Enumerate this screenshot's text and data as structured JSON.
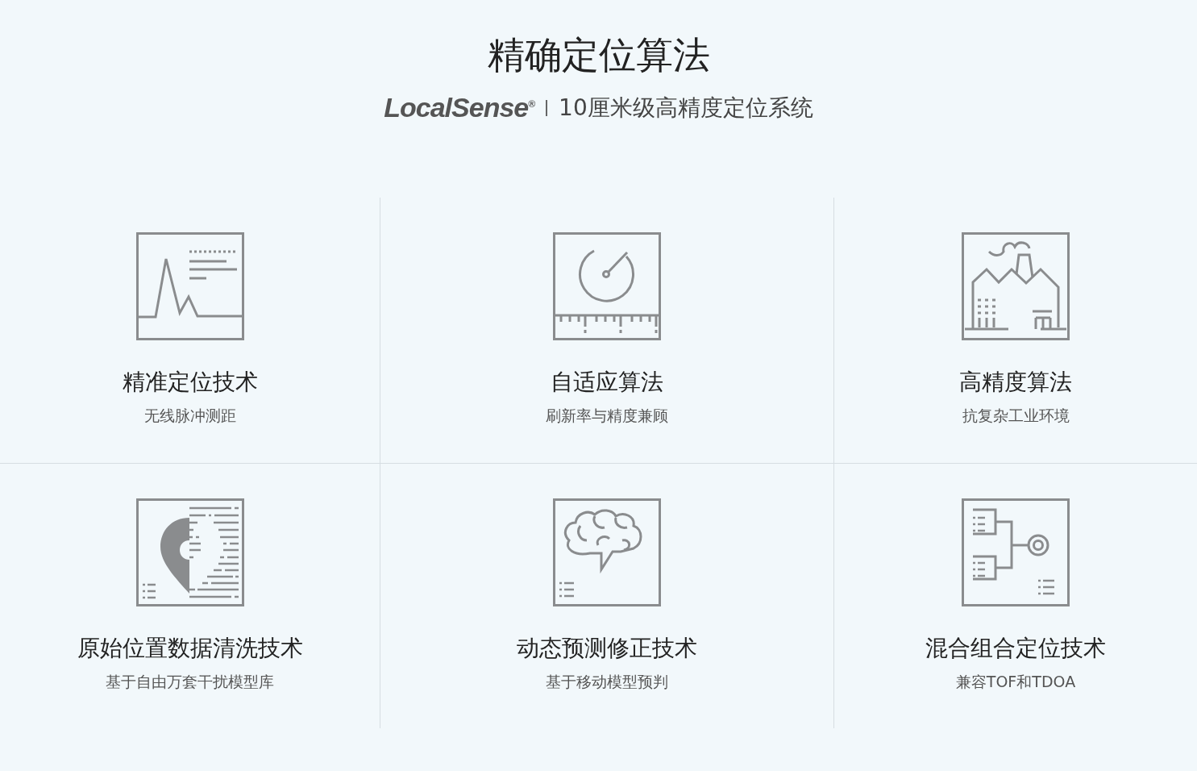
{
  "title": "精确定位算法",
  "subtitle": {
    "brand": "LocalSense$^{®}$",
    "text": "10厘米级高精度定位系统"
  },
  "features": [
    {
      "kind": "chart",
      "title": "精准定位技术",
      "desc": "无线脉冲测距"
    },
    {
      "kind": "gauge",
      "title": "自适应算法",
      "desc": "刷新率与精度兼顾"
    },
    {
      "kind": "factory",
      "title": "高精度算法",
      "desc": "抗复杂工业环境"
    },
    {
      "kind": "pin",
      "title": "原始位置数据清洗技术",
      "desc": "基于自由万套干扰模型库"
    },
    {
      "kind": "brain",
      "title": "动态预测修正技术",
      "desc": "基于移动模型预判"
    },
    {
      "kind": "tree",
      "title": "混合组合定位技术",
      "desc": "兼容TOF和TDOA"
    }
  ]
}
